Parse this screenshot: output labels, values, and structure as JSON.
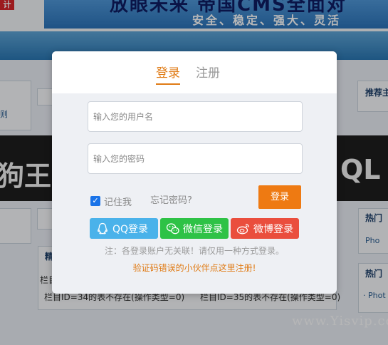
{
  "background": {
    "logo_text": "计",
    "banner_line1": "放眼未来 帝国CMS全面对",
    "banner_line2": "安全、稳定、强大、灵活",
    "left_links": [
      "则"
    ],
    "box_titles": [
      "推荐主",
      "精",
      "热门",
      "热门"
    ],
    "side_links": [
      "Pho",
      "· Phot"
    ],
    "black_band_left": "狗王—",
    "black_band_right": "QL",
    "bottom_label": "栏目",
    "bottom_text_1": "栏目ID=34的表不存在(操作类型=0)",
    "bottom_text_2": "栏目ID=35的表不存在(操作类型=0)",
    "watermark": "www.Yisvip.com"
  },
  "modal": {
    "tabs": [
      {
        "label": "登录",
        "active": true
      },
      {
        "label": "注册",
        "active": false
      }
    ],
    "username_placeholder": "输入您的用户名",
    "password_placeholder": "输入您的密码",
    "remember_label": "记住我",
    "remember_checked": true,
    "forgot_label": "忘记密码?",
    "login_button": "登录",
    "social": [
      {
        "label": "QQ登录",
        "icon": "qq-icon",
        "color": "#4ab2ea"
      },
      {
        "label": "微信登录",
        "icon": "wechat-icon",
        "color": "#2ec246"
      },
      {
        "label": "微博登录",
        "icon": "weibo-icon",
        "color": "#ea4e3d"
      }
    ],
    "note": "注：各登录账户无关联！请仅用一种方式登录。",
    "register_link": "验证码错误的小伙伴点这里注册!"
  },
  "colors": {
    "accent": "#e07b15",
    "login_button": "#ee7a12",
    "checkbox": "#1a73e8"
  }
}
